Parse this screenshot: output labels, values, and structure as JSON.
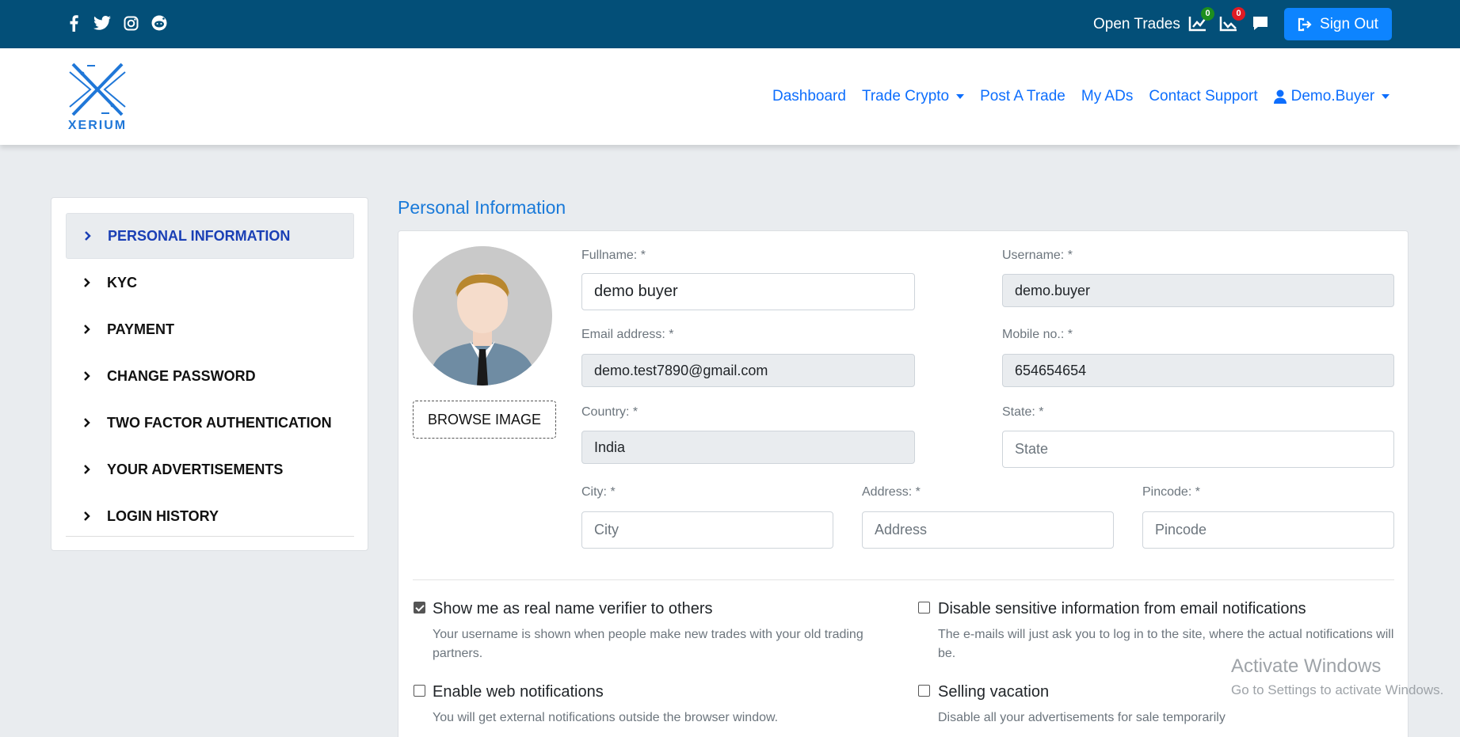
{
  "topbar": {
    "social_icons": [
      "facebook-icon",
      "twitter-icon",
      "instagram-icon",
      "reddit-icon"
    ],
    "open_trades_label": "Open Trades",
    "buy_trades_count": "0",
    "sell_trades_count": "0",
    "sign_out_label": "Sign Out"
  },
  "header": {
    "logo_text": "XERIUM",
    "nav": {
      "dashboard": "Dashboard",
      "trade_crypto": "Trade Crypto",
      "post_trade": "Post A Trade",
      "my_ads": "My ADs",
      "contact_support": "Contact Support",
      "user": "Demo.Buyer"
    }
  },
  "sidebar": {
    "items": [
      {
        "label": "PERSONAL INFORMATION",
        "active": true
      },
      {
        "label": "KYC"
      },
      {
        "label": "PAYMENT"
      },
      {
        "label": "CHANGE PASSWORD"
      },
      {
        "label": "TWO FACTOR AUTHENTICATION"
      },
      {
        "label": "YOUR ADVERTISEMENTS"
      },
      {
        "label": "LOGIN HISTORY"
      }
    ]
  },
  "main": {
    "title": "Personal Information",
    "browse_label": "BROWSE IMAGE",
    "fields": {
      "fullname": {
        "label": "Fullname: *",
        "value": "demo buyer"
      },
      "username": {
        "label": "Username: *",
        "value": "demo.buyer"
      },
      "email": {
        "label": "Email address: *",
        "value": "demo.test7890@gmail.com"
      },
      "mobile": {
        "label": "Mobile no.: *",
        "value": "654654654"
      },
      "country": {
        "label": "Country: *",
        "value": "India"
      },
      "state": {
        "label": "State: *",
        "placeholder": "State"
      },
      "city": {
        "label": "City: *",
        "placeholder": "City"
      },
      "address": {
        "label": "Address: *",
        "placeholder": "Address"
      },
      "pincode": {
        "label": "Pincode: *",
        "placeholder": "Pincode"
      }
    },
    "options": {
      "real_name": {
        "title": "Show me as real name verifier to others",
        "desc": "Your username is shown when people make new trades with your old trading partners.",
        "checked": true
      },
      "disable_sensitive": {
        "title": "Disable sensitive information from email notifications",
        "desc": "The e-mails will just ask you to log in to the site, where the actual notifications will be.",
        "checked": false
      },
      "web_notifications": {
        "title": "Enable web notifications",
        "desc": "You will get external notifications outside the browser window.",
        "checked": false
      },
      "selling_vacation": {
        "title": "Selling vacation",
        "desc": "Disable all your advertisements for sale temporarily",
        "checked": false
      }
    }
  },
  "watermark": {
    "line1": "Activate Windows",
    "line2": "Go to Settings to activate Windows."
  },
  "colors": {
    "topbar": "#034f78",
    "accent": "#0d84ff",
    "link": "#0d6efd"
  }
}
